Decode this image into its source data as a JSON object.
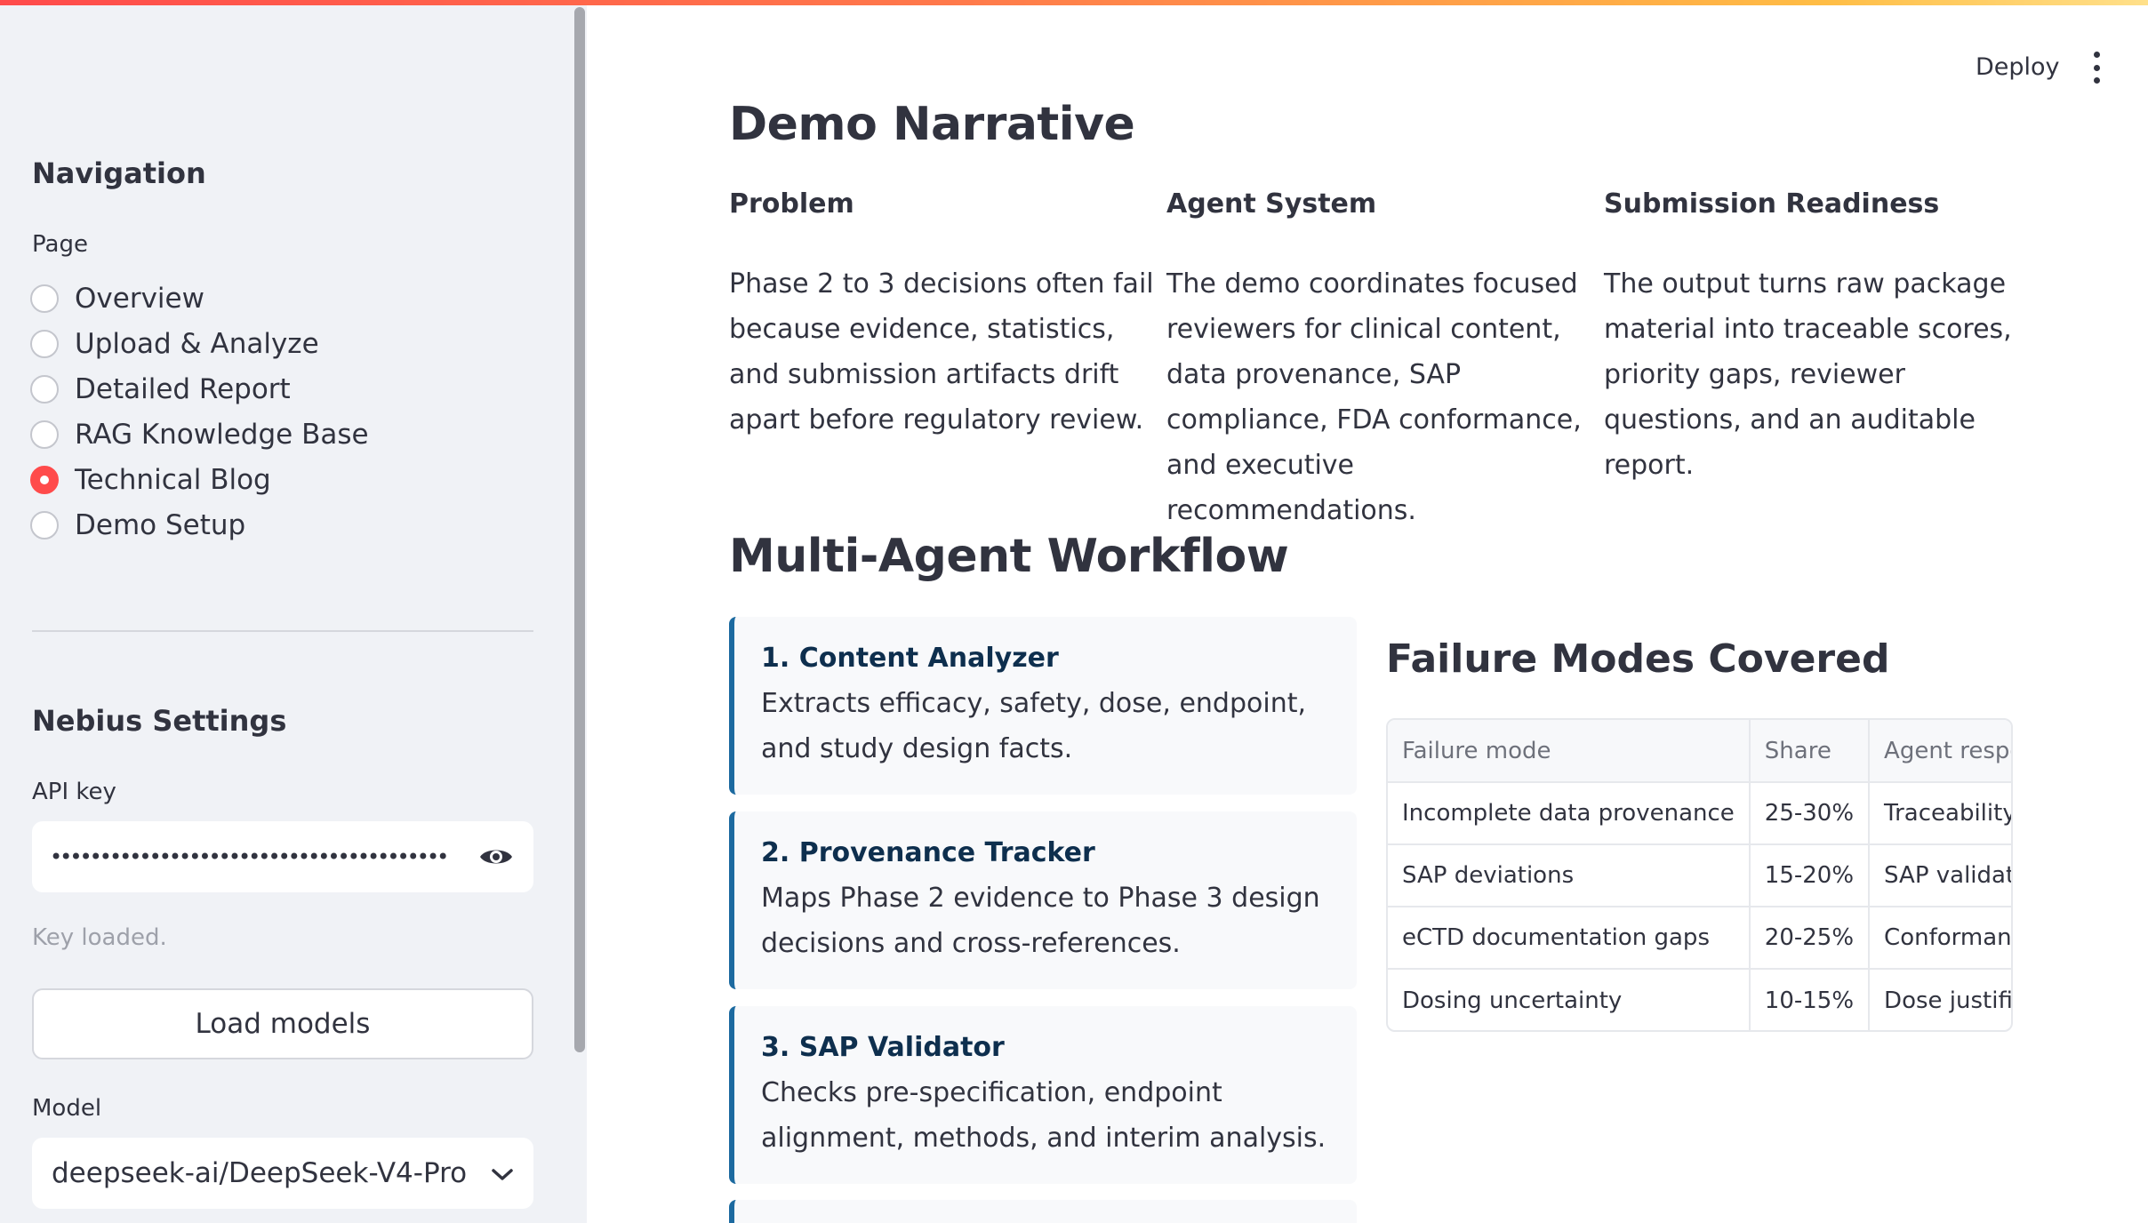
{
  "header": {
    "deploy_label": "Deploy"
  },
  "sidebar": {
    "nav_title": "Navigation",
    "page_label": "Page",
    "pages": [
      {
        "label": "Overview",
        "selected": false
      },
      {
        "label": "Upload & Analyze",
        "selected": false
      },
      {
        "label": "Detailed Report",
        "selected": false
      },
      {
        "label": "RAG Knowledge Base",
        "selected": false
      },
      {
        "label": "Technical Blog",
        "selected": true
      },
      {
        "label": "Demo Setup",
        "selected": false
      }
    ],
    "settings_title": "Nebius Settings",
    "api_key_label": "API key",
    "api_key_masked": "••••••••••••••••••••••••••••••••••••••••",
    "key_status": "Key loaded.",
    "load_models_label": "Load models",
    "model_label": "Model",
    "model_value": "deepseek-ai/DeepSeek-V4-Pro"
  },
  "main": {
    "title": "Demo Narrative",
    "columns": [
      {
        "title": "Problem",
        "text": "Phase 2 to 3 decisions often fail because evidence, statistics, and submission artifacts drift apart before regulatory review."
      },
      {
        "title": "Agent System",
        "text": "The demo coordinates focused reviewers for clinical content, data provenance, SAP compliance, FDA conformance, and executive recommendations."
      },
      {
        "title": "Submission Readiness",
        "text": "The output turns raw package material into traceable scores, priority gaps, reviewer questions, and an auditable report."
      }
    ],
    "workflow_title": "Multi-Agent Workflow",
    "agents": [
      {
        "title": "1. Content Analyzer",
        "text": "Extracts efficacy, safety, dose, endpoint, and study design facts."
      },
      {
        "title": "2. Provenance Tracker",
        "text": "Maps Phase 2 evidence to Phase 3 design decisions and cross-references."
      },
      {
        "title": "3. SAP Validator",
        "text": "Checks pre-specification, endpoint alignment, methods, and interim analysis."
      }
    ],
    "failure_title": "Failure Modes Covered",
    "table": {
      "headers": [
        "Failure mode",
        "Share",
        "Agent response"
      ],
      "rows": [
        [
          "Incomplete data provenance",
          "25-30%",
          "Traceability map"
        ],
        [
          "SAP deviations",
          "15-20%",
          "SAP validation"
        ],
        [
          "eCTD documentation gaps",
          "20-25%",
          "Conformance che"
        ],
        [
          "Dosing uncertainty",
          "10-15%",
          "Dose justification"
        ]
      ]
    }
  },
  "colors": {
    "accent": "#ff4b4b",
    "card_border": "#1c6aa0",
    "sidebar_bg": "#f0f2f6"
  }
}
